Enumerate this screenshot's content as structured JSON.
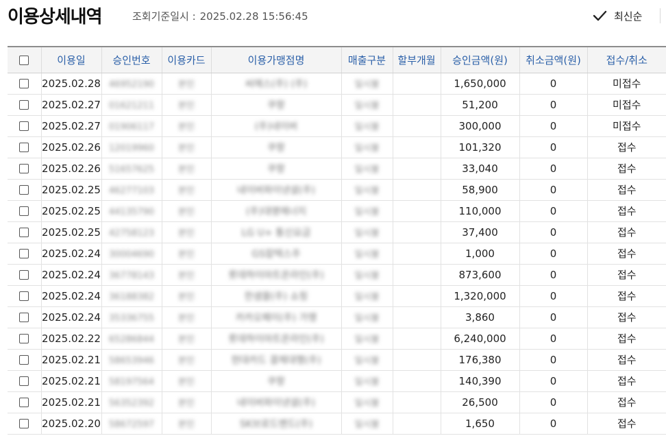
{
  "page": {
    "title": "이용상세내역",
    "query_label": "조회기준일시 :",
    "query_datetime": "2025.02.28 15:56:45",
    "sort_label": "최신순"
  },
  "table": {
    "headers": [
      "",
      "이용일",
      "승인번호",
      "이용카드",
      "이용가맹점명",
      "매출구분",
      "할부개월",
      "승인금액(원)",
      "취소금액(원)",
      "접수/취소"
    ],
    "rows": [
      {
        "date": "2025.02.28",
        "approval_no": "46952190",
        "card": "본인",
        "merchant": "씨에스(주) (주)",
        "sales_type": "일시불",
        "installment": "",
        "amount": "1,650,000",
        "cancel": "0",
        "status": "미접수"
      },
      {
        "date": "2025.02.27",
        "approval_no": "01621211",
        "card": "본인",
        "merchant": "쿠팡",
        "sales_type": "일시불",
        "installment": "",
        "amount": "51,200",
        "cancel": "0",
        "status": "미접수"
      },
      {
        "date": "2025.02.27",
        "approval_no": "01906117",
        "card": "본인",
        "merchant": "(주)네이버",
        "sales_type": "일시불",
        "installment": "",
        "amount": "300,000",
        "cancel": "0",
        "status": "미접수"
      },
      {
        "date": "2025.02.26",
        "approval_no": "12019960",
        "card": "본인",
        "merchant": "쿠팡",
        "sales_type": "일시불",
        "installment": "",
        "amount": "101,320",
        "cancel": "0",
        "status": "접수"
      },
      {
        "date": "2025.02.26",
        "approval_no": "51657625",
        "card": "본인",
        "merchant": "쿠팡",
        "sales_type": "일시불",
        "installment": "",
        "amount": "33,040",
        "cancel": "0",
        "status": "접수"
      },
      {
        "date": "2025.02.25",
        "approval_no": "46277103",
        "card": "본인",
        "merchant": "네이버파이낸셜(주)",
        "sales_type": "일시불",
        "installment": "",
        "amount": "58,900",
        "cancel": "0",
        "status": "접수"
      },
      {
        "date": "2025.02.25",
        "approval_no": "44135790",
        "card": "본인",
        "merchant": "(주)대명에너지",
        "sales_type": "일시불",
        "installment": "",
        "amount": "110,000",
        "cancel": "0",
        "status": "접수"
      },
      {
        "date": "2025.02.25",
        "approval_no": "42758123",
        "card": "본인",
        "merchant": "LG U+ 통신요금",
        "sales_type": "일시불",
        "installment": "",
        "amount": "37,400",
        "cancel": "0",
        "status": "접수"
      },
      {
        "date": "2025.02.24",
        "approval_no": "30004690",
        "card": "본인",
        "merchant": "GS칼텍스주",
        "sales_type": "일시불",
        "installment": "",
        "amount": "1,000",
        "cancel": "0",
        "status": "접수"
      },
      {
        "date": "2025.02.24",
        "approval_no": "36778143",
        "card": "본인",
        "merchant": "롯데하이마트온라인(주)",
        "sales_type": "일시불",
        "installment": "",
        "amount": "873,600",
        "cancel": "0",
        "status": "접수"
      },
      {
        "date": "2025.02.24",
        "approval_no": "36188382",
        "card": "본인",
        "merchant": "한샘몰(주) 쇼핑",
        "sales_type": "일시불",
        "installment": "",
        "amount": "1,320,000",
        "cancel": "0",
        "status": "접수"
      },
      {
        "date": "2025.02.24",
        "approval_no": "35336755",
        "card": "본인",
        "merchant": "카카오페이(주) 가맹",
        "sales_type": "일시불",
        "installment": "",
        "amount": "3,860",
        "cancel": "0",
        "status": "접수"
      },
      {
        "date": "2025.02.22",
        "approval_no": "65286844",
        "card": "본인",
        "merchant": "롯데하이마트온라인(주)",
        "sales_type": "일시불",
        "installment": "",
        "amount": "6,240,000",
        "cancel": "0",
        "status": "접수"
      },
      {
        "date": "2025.02.21",
        "approval_no": "58653946",
        "card": "본인",
        "merchant": "현대카드 결제대행(주)",
        "sales_type": "일시불",
        "installment": "",
        "amount": "176,380",
        "cancel": "0",
        "status": "접수"
      },
      {
        "date": "2025.02.21",
        "approval_no": "58197564",
        "card": "본인",
        "merchant": "쿠팡",
        "sales_type": "일시불",
        "installment": "",
        "amount": "140,390",
        "cancel": "0",
        "status": "접수"
      },
      {
        "date": "2025.02.21",
        "approval_no": "56352392",
        "card": "본인",
        "merchant": "네이버파이낸셜(주)",
        "sales_type": "일시불",
        "installment": "",
        "amount": "26,500",
        "cancel": "0",
        "status": "접수"
      },
      {
        "date": "2025.02.20",
        "approval_no": "58672597",
        "card": "본인",
        "merchant": "SK브로드밴드(주)",
        "sales_type": "일시불",
        "installment": "",
        "amount": "1,650",
        "cancel": "0",
        "status": "접수"
      }
    ]
  },
  "icons": {
    "sort": "check-icon",
    "row_select": "checkbox-icon"
  },
  "colors": {
    "header_text": "#2a5fa8",
    "header_bg": "#f4f4f4",
    "border_top": "#8c8c8c"
  }
}
